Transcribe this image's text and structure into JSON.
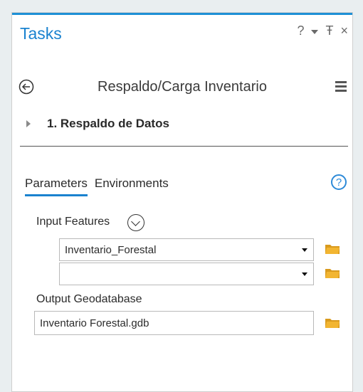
{
  "window": {
    "title": "Tasks",
    "help_label": "?",
    "pin_label": "Ŧ",
    "close_label": "×"
  },
  "task": {
    "name": "Respaldo/Carga Inventario"
  },
  "step": {
    "label": "1. Respaldo de Datos"
  },
  "tabs": [
    {
      "label": "Parameters",
      "active": true
    },
    {
      "label": "Environments",
      "active": false
    }
  ],
  "help_button": "?",
  "params": {
    "input_features_label": "Input Features",
    "input_features_values": [
      "Inventario_Forestal",
      ""
    ],
    "output_geodatabase_label": "Output Geodatabase",
    "output_geodatabase_value": "Inventario Forestal.gdb"
  },
  "colors": {
    "accent": "#1a82cf",
    "folder": "#f2b531"
  },
  "icons": {
    "back": "back-arrow-icon",
    "menu": "hamburger-menu-icon",
    "folder": "folder-icon",
    "expand": "chevron-down-circle-icon",
    "help": "help-icon"
  }
}
